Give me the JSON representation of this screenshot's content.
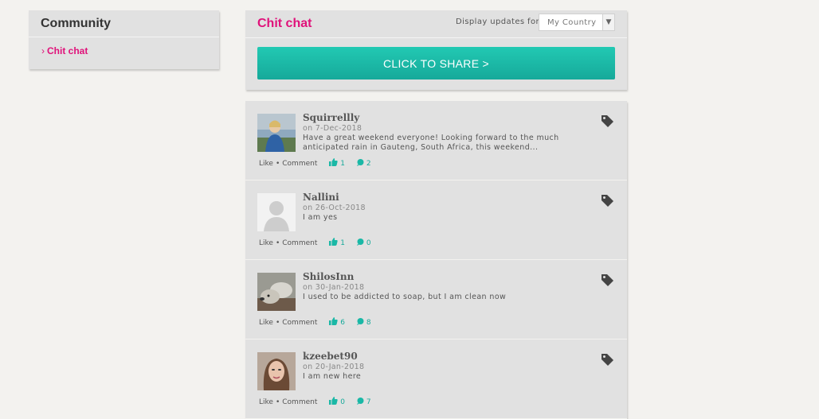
{
  "sidebar": {
    "title": "Community",
    "items": [
      {
        "label": "Chit chat",
        "chevron": "›"
      }
    ]
  },
  "header": {
    "title": "Chit chat",
    "display_label": "Display updates for:",
    "display_select": {
      "value": "My Country"
    },
    "share_button_label": "CLICK TO SHARE >"
  },
  "colors": {
    "accent": "#e0127a",
    "teal": "#1ab8a6",
    "panel": "#e1e1e1"
  },
  "posts": [
    {
      "name": "Squirrellly",
      "date": "on 7-Dec-2018",
      "text": "Have a great weekend everyone! Looking forward to the much anticipated rain in Gauteng, South Africa, this weekend...",
      "likes": "1",
      "comments": "2",
      "avatar": "photo-woman-outdoors"
    },
    {
      "name": "Nallini",
      "date": "on 26-Oct-2018",
      "text": "I am yes",
      "likes": "1",
      "comments": "0",
      "avatar": "default-user-icon"
    },
    {
      "name": "ShilosInn",
      "date": "on 30-Jan-2018",
      "text": "I used to be addicted to soap, but I am clean now",
      "likes": "6",
      "comments": "8",
      "avatar": "photo-dog"
    },
    {
      "name": "kzeebet90",
      "date": "on 20-Jan-2018",
      "text": "I am new here",
      "likes": "0",
      "comments": "7",
      "avatar": "photo-woman-portrait"
    }
  ],
  "actions": {
    "like": "Like",
    "separator": "•",
    "comment": "Comment"
  }
}
